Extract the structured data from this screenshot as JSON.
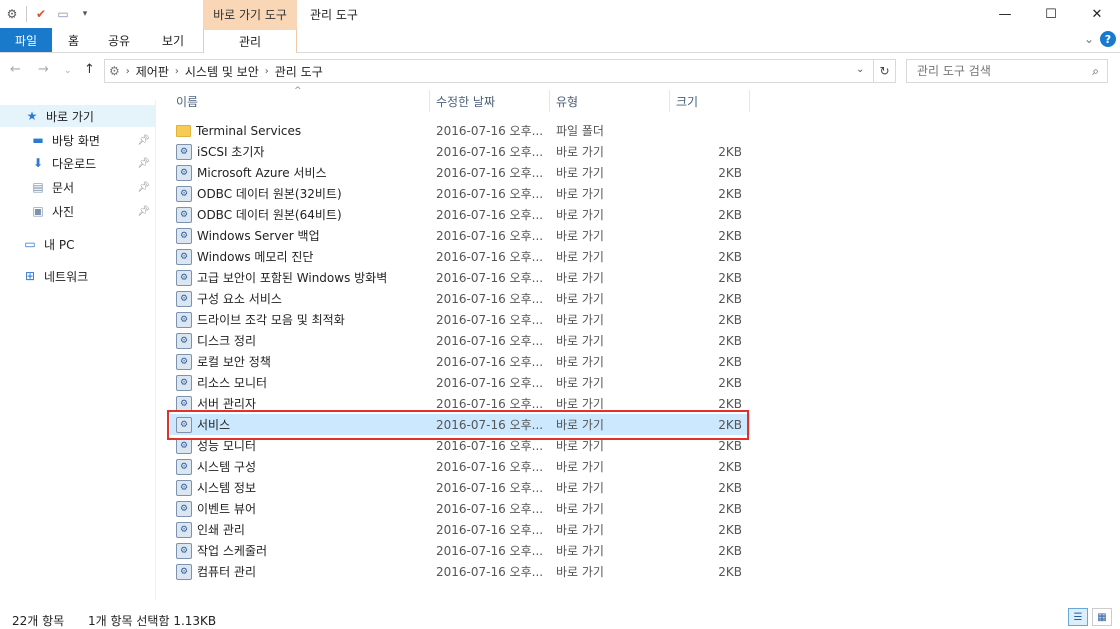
{
  "window": {
    "title": "관리 도구",
    "context_tab_group": "바로 가기 도구",
    "controls": {
      "minimize": "—",
      "maximize": "☐",
      "close": "✕"
    }
  },
  "ribbon": {
    "tabs": {
      "file": "파일",
      "home": "홈",
      "share": "공유",
      "view": "보기",
      "manage": "관리"
    },
    "help": "?",
    "collapse": "⌄"
  },
  "address": {
    "breadcrumb": [
      "제어판",
      "시스템 및 보안",
      "관리 도구"
    ],
    "search_placeholder": "관리 도구 검색"
  },
  "sidebar": {
    "quick_access": "바로 가기",
    "items": [
      {
        "label": "바탕 화면",
        "icon": "desktop-icon"
      },
      {
        "label": "다운로드",
        "icon": "download-icon"
      },
      {
        "label": "문서",
        "icon": "document-icon"
      },
      {
        "label": "사진",
        "icon": "picture-icon"
      }
    ],
    "this_pc": "내 PC",
    "network": "네트워크"
  },
  "columns": {
    "name": "이름",
    "modified": "수정한 날짜",
    "type": "유형",
    "size": "크기"
  },
  "files": [
    {
      "name": "Terminal Services",
      "date": "2016-07-16 오후...",
      "type": "파일 폴더",
      "size": "",
      "icon": "folder-icon"
    },
    {
      "name": "iSCSI 초기자",
      "date": "2016-07-16 오후...",
      "type": "바로 가기",
      "size": "2KB",
      "icon": "iscsi-icon"
    },
    {
      "name": "Microsoft Azure 서비스",
      "date": "2016-07-16 오후...",
      "type": "바로 가기",
      "size": "2KB",
      "icon": "azure-icon"
    },
    {
      "name": "ODBC 데이터 원본(32비트)",
      "date": "2016-07-16 오후...",
      "type": "바로 가기",
      "size": "2KB",
      "icon": "odbc-icon"
    },
    {
      "name": "ODBC 데이터 원본(64비트)",
      "date": "2016-07-16 오후...",
      "type": "바로 가기",
      "size": "2KB",
      "icon": "odbc-icon"
    },
    {
      "name": "Windows Server 백업",
      "date": "2016-07-16 오후...",
      "type": "바로 가기",
      "size": "2KB",
      "icon": "backup-icon"
    },
    {
      "name": "Windows 메모리 진단",
      "date": "2016-07-16 오후...",
      "type": "바로 가기",
      "size": "2KB",
      "icon": "memory-icon"
    },
    {
      "name": "고급 보안이 포함된 Windows 방화벽",
      "date": "2016-07-16 오후...",
      "type": "바로 가기",
      "size": "2KB",
      "icon": "firewall-icon"
    },
    {
      "name": "구성 요소 서비스",
      "date": "2016-07-16 오후...",
      "type": "바로 가기",
      "size": "2KB",
      "icon": "component-icon"
    },
    {
      "name": "드라이브 조각 모음 및 최적화",
      "date": "2016-07-16 오후...",
      "type": "바로 가기",
      "size": "2KB",
      "icon": "defrag-icon"
    },
    {
      "name": "디스크 정리",
      "date": "2016-07-16 오후...",
      "type": "바로 가기",
      "size": "2KB",
      "icon": "disk-cleanup-icon"
    },
    {
      "name": "로컬 보안 정책",
      "date": "2016-07-16 오후...",
      "type": "바로 가기",
      "size": "2KB",
      "icon": "security-policy-icon"
    },
    {
      "name": "리소스 모니터",
      "date": "2016-07-16 오후...",
      "type": "바로 가기",
      "size": "2KB",
      "icon": "resource-monitor-icon"
    },
    {
      "name": "서버 관리자",
      "date": "2016-07-16 오후...",
      "type": "바로 가기",
      "size": "2KB",
      "icon": "server-manager-icon"
    },
    {
      "name": "서비스",
      "date": "2016-07-16 오후...",
      "type": "바로 가기",
      "size": "2KB",
      "icon": "services-icon",
      "selected": true
    },
    {
      "name": "성능 모니터",
      "date": "2016-07-16 오후...",
      "type": "바로 가기",
      "size": "2KB",
      "icon": "performance-icon"
    },
    {
      "name": "시스템 구성",
      "date": "2016-07-16 오후...",
      "type": "바로 가기",
      "size": "2KB",
      "icon": "system-config-icon"
    },
    {
      "name": "시스템 정보",
      "date": "2016-07-16 오후...",
      "type": "바로 가기",
      "size": "2KB",
      "icon": "system-info-icon"
    },
    {
      "name": "이벤트 뷰어",
      "date": "2016-07-16 오후...",
      "type": "바로 가기",
      "size": "2KB",
      "icon": "event-viewer-icon"
    },
    {
      "name": "인쇄 관리",
      "date": "2016-07-16 오후...",
      "type": "바로 가기",
      "size": "2KB",
      "icon": "print-icon"
    },
    {
      "name": "작업 스케줄러",
      "date": "2016-07-16 오후...",
      "type": "바로 가기",
      "size": "2KB",
      "icon": "scheduler-icon"
    },
    {
      "name": "컴퓨터 관리",
      "date": "2016-07-16 오후...",
      "type": "바로 가기",
      "size": "2KB",
      "icon": "computer-management-icon"
    }
  ],
  "status": {
    "count": "22개 항목",
    "selection": "1개 항목 선택함 1.13KB"
  },
  "colors": {
    "accent": "#1979ca",
    "context_tab": "#f9d6b5",
    "selection": "#cce8ff",
    "highlight": "#e0312d"
  }
}
